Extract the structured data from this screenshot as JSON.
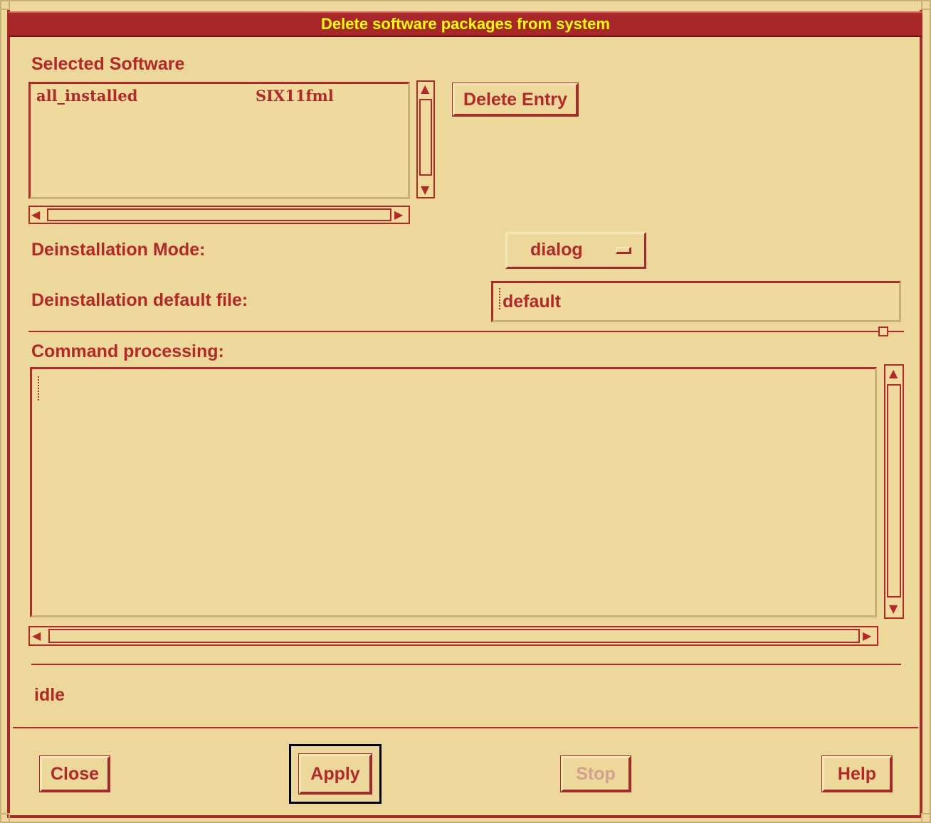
{
  "window": {
    "title": "Delete software packages from system"
  },
  "selected_software": {
    "label": "Selected Software",
    "items": [
      {
        "name": "all_installed",
        "value": "SIX11fml"
      }
    ],
    "delete_entry_label": "Delete Entry"
  },
  "deinstallation": {
    "mode_label": "Deinstallation Mode:",
    "mode_value": "dialog",
    "default_file_label": "Deinstallation default file:",
    "default_file_value": "default"
  },
  "command": {
    "label": "Command processing:",
    "content": ""
  },
  "status": {
    "text": "idle"
  },
  "buttons": {
    "close": "Close",
    "apply": "Apply",
    "stop": "Stop",
    "help": "Help"
  },
  "colors": {
    "background": "#ecd89a",
    "accent": "#b5282a",
    "title_text": "#ffff00"
  }
}
